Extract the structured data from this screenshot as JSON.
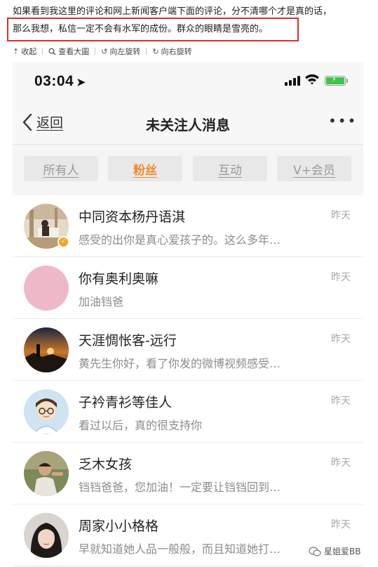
{
  "article": {
    "line1": "如果看到我这里的评论和网上新闻客户端下面的评论，分不清哪个才是真的话，",
    "line2": "那么我想，私信一定不会有水军的成份。群众的眼睛是雪亮的。"
  },
  "image_toolbar": {
    "collapse": "收起",
    "view_large": "查看大圖",
    "rotate_left": "向左旋转",
    "rotate_right": "向右旋转"
  },
  "status_bar": {
    "time": "03:04",
    "location_arrow": "➤"
  },
  "nav": {
    "back_label": "返回",
    "title": "未关注人消息",
    "more": "•••"
  },
  "tabs": [
    {
      "label": "所有人",
      "active": false
    },
    {
      "label": "粉丝",
      "active": true
    },
    {
      "label": "互动",
      "active": false
    },
    {
      "label": "V+会员",
      "active": false
    }
  ],
  "messages": [
    {
      "name": "中同资本杨丹语淇",
      "preview": "感受的出你是真心爱孩子的。这么多年…",
      "time": "昨天",
      "verified": true
    },
    {
      "name": "你有奥利奥嘛",
      "preview": "加油铛爸",
      "time": "昨天",
      "verified": false
    },
    {
      "name": "天涯惆怅客-远行",
      "preview": "黄先生你好，看了你发的微博视频感受…",
      "time": "昨天",
      "verified": false
    },
    {
      "name": "子衿青衫等佳人",
      "preview": "看过以后，真的很支持你",
      "time": "昨天",
      "verified": false
    },
    {
      "name": "乏木女孩",
      "preview": "铛铛爸爸，您加油！一定要让铛铛回到…",
      "time": "昨天",
      "verified": false
    },
    {
      "name": "周家小小格格",
      "preview": "早就知道她人品一般般，而且知道她打…",
      "time": "昨天",
      "verified": false
    }
  ],
  "watermark": {
    "text": "星姐爱BB"
  },
  "colors": {
    "accent_orange": "#f08a2b",
    "highlight_red": "#d9302b",
    "battery_green": "#3dc449",
    "verified_gold": "#f5a623"
  }
}
